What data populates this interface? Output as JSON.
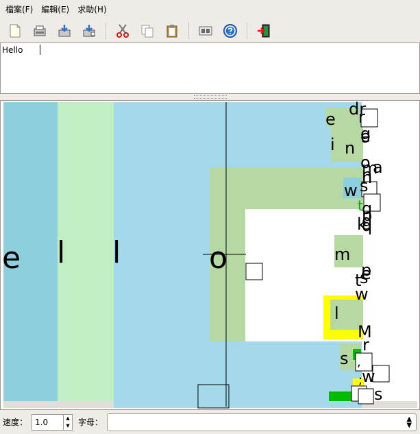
{
  "menu": {
    "items": [
      {
        "label": "檔案(F)"
      },
      {
        "label": "編輯(E)"
      },
      {
        "label": "求助(H)"
      }
    ]
  },
  "toolbar": {
    "icons": [
      "new-icon",
      "open-icon",
      "save-icon",
      "save-as-icon",
      "cut-icon",
      "copy-icon",
      "paste-icon",
      "preferences-icon",
      "help-icon",
      "quit-icon"
    ]
  },
  "editor": {
    "text": "Hello"
  },
  "canvas": {
    "big_letters": [
      "e",
      "l",
      "l",
      "o"
    ],
    "small_letters": [
      "dr",
      "e",
      "r",
      "g",
      "i",
      "n",
      "e",
      "o",
      "n",
      "m",
      "a",
      "n",
      "w",
      "s",
      "t",
      "q",
      "p",
      "k",
      "q",
      "g",
      "m",
      "p",
      "e",
      "t",
      "s",
      "w",
      "l",
      "M",
      "r",
      "s",
      ",",
      ";",
      "w",
      "s"
    ],
    "colors": {
      "col1": "#8ccfdd",
      "col2": "#c2eec4",
      "col3": "#a3d9ea",
      "block": "#b6d9a3",
      "highlight": "#ffff00",
      "accent": "#00bb00"
    }
  },
  "status": {
    "speed_label": "速度：",
    "speed_value": "1.0",
    "letters_label": "字母："
  }
}
